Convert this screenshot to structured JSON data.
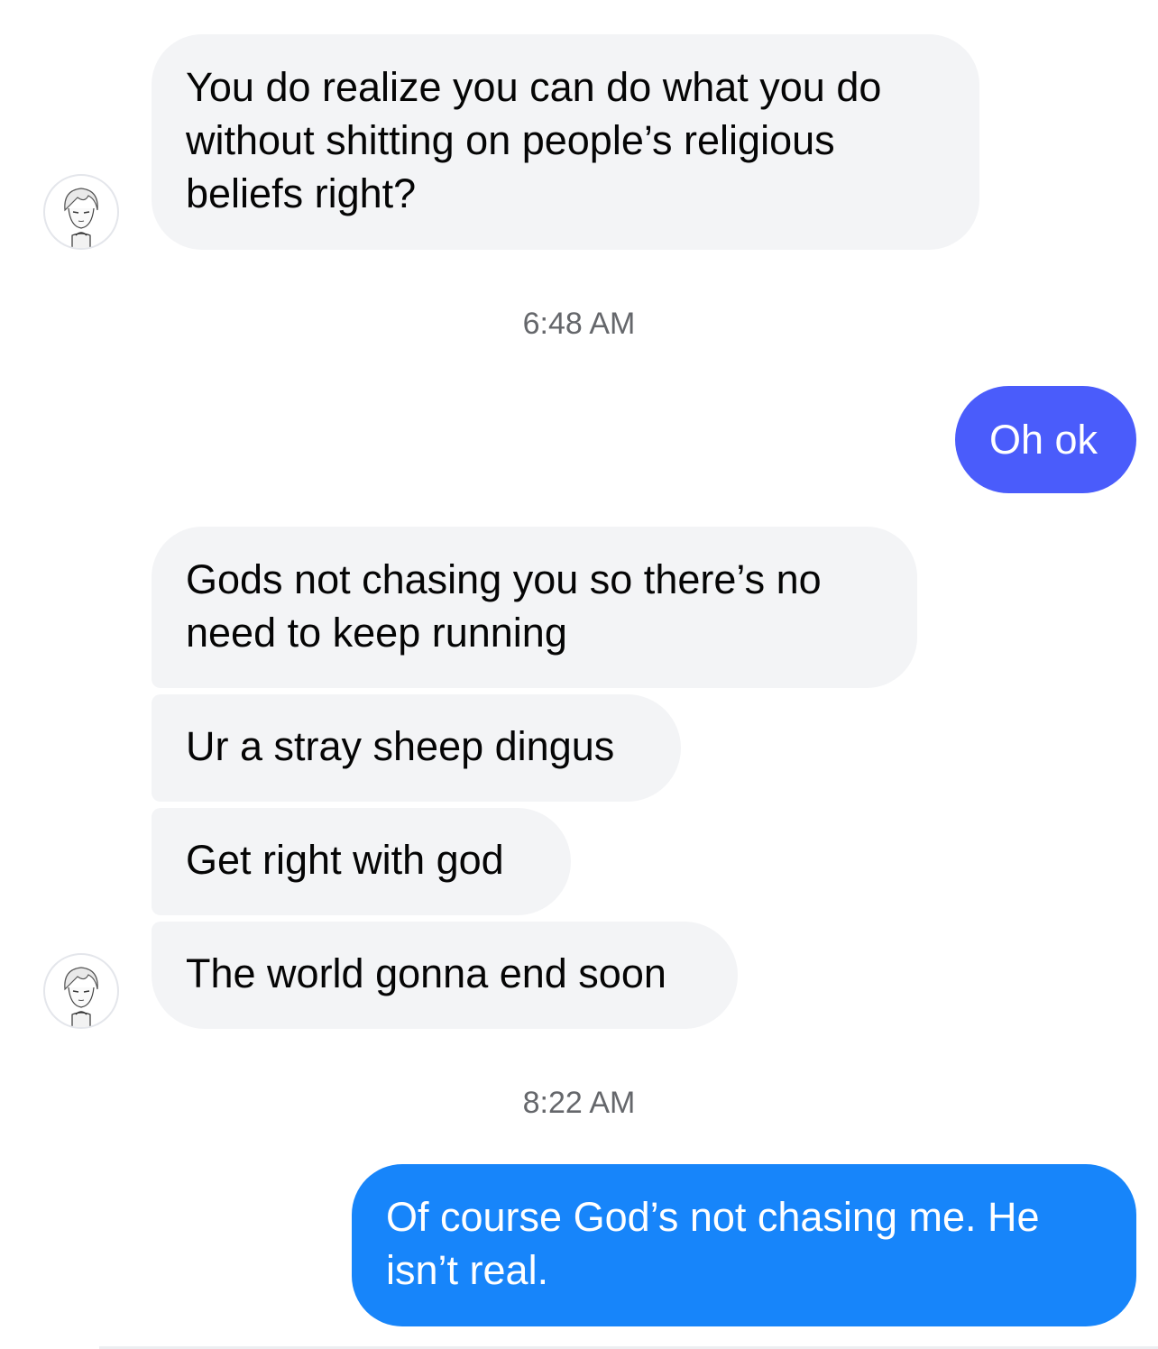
{
  "messages": [
    {
      "sender": "other",
      "text": "You do realize you can do what you do without shitting on people’s religious beliefs right?"
    },
    {
      "sender": "me",
      "text": "Oh ok"
    },
    {
      "sender": "other",
      "text": "Gods not chasing you so there’s no need to keep running"
    },
    {
      "sender": "other",
      "text": "Ur a stray sheep dingus"
    },
    {
      "sender": "other",
      "text": "Get right with god"
    },
    {
      "sender": "other",
      "text": "The world gonna end soon"
    },
    {
      "sender": "me",
      "text": "Of course God’s not chasing me. He isn’t real."
    }
  ],
  "timestamps": [
    "6:48 AM",
    "8:22 AM"
  ],
  "colors": {
    "incoming_bubble": "#f3f4f6",
    "outgoing_bubble_indigo": "#4a5cfb",
    "outgoing_bubble_blue": "#1785fa",
    "timestamp_text": "#65676b"
  },
  "avatar": {
    "icon": "anime-profile-avatar-icon"
  }
}
